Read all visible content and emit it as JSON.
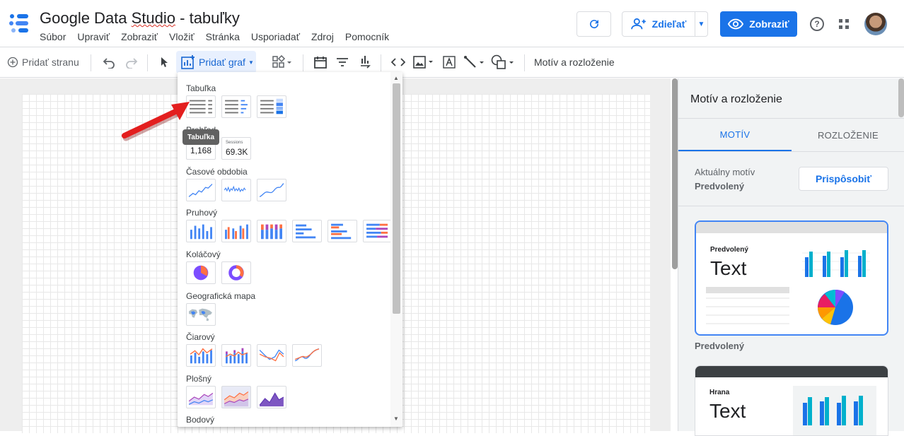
{
  "app": {
    "title": "Google Data Studio - tabuľky",
    "title_parts": [
      "Google Data ",
      "Studio",
      " - tabuľky"
    ],
    "menu": [
      "Súbor",
      "Upraviť",
      "Zobraziť",
      "Vložiť",
      "Stránka",
      "Usporiadať",
      "Zdroj",
      "Pomocník"
    ]
  },
  "header": {
    "share_label": "Zdieľať",
    "view_label": "Zobraziť",
    "help_glyph": "?",
    "accent": "#1a73e8"
  },
  "toolbar": {
    "add_page": "Pridať stranu",
    "add_chart": "Pridať graf",
    "theme_layout": "Motív a rozloženie"
  },
  "chart_menu": {
    "sections": {
      "table": "Tabuľka",
      "scorecard": "Prehľad",
      "timeseries": "Časové obdobia",
      "bar": "Pruhový",
      "pie": "Koláčový",
      "geo": "Geografická mapa",
      "line": "Čiarový",
      "area": "Plošný",
      "scatter": "Bodový"
    },
    "scorecard_1_value": "1,168",
    "scorecard_2_label": "Sessions",
    "scorecard_2_value": "69.3K",
    "tooltip": "Tabuľka"
  },
  "right_panel": {
    "title": "Motív a rozloženie",
    "tabs": [
      "MOTÍV",
      "ROZLOŽENIE"
    ],
    "current_label": "Aktuálny motív",
    "current_value": "Predvolený",
    "customize": "Prispôsobiť",
    "theme1_name": "Predvolený",
    "theme1_text": "Text",
    "theme1_label": "Predvolený",
    "theme2_name": "Hrana",
    "theme2_text": "Text"
  }
}
